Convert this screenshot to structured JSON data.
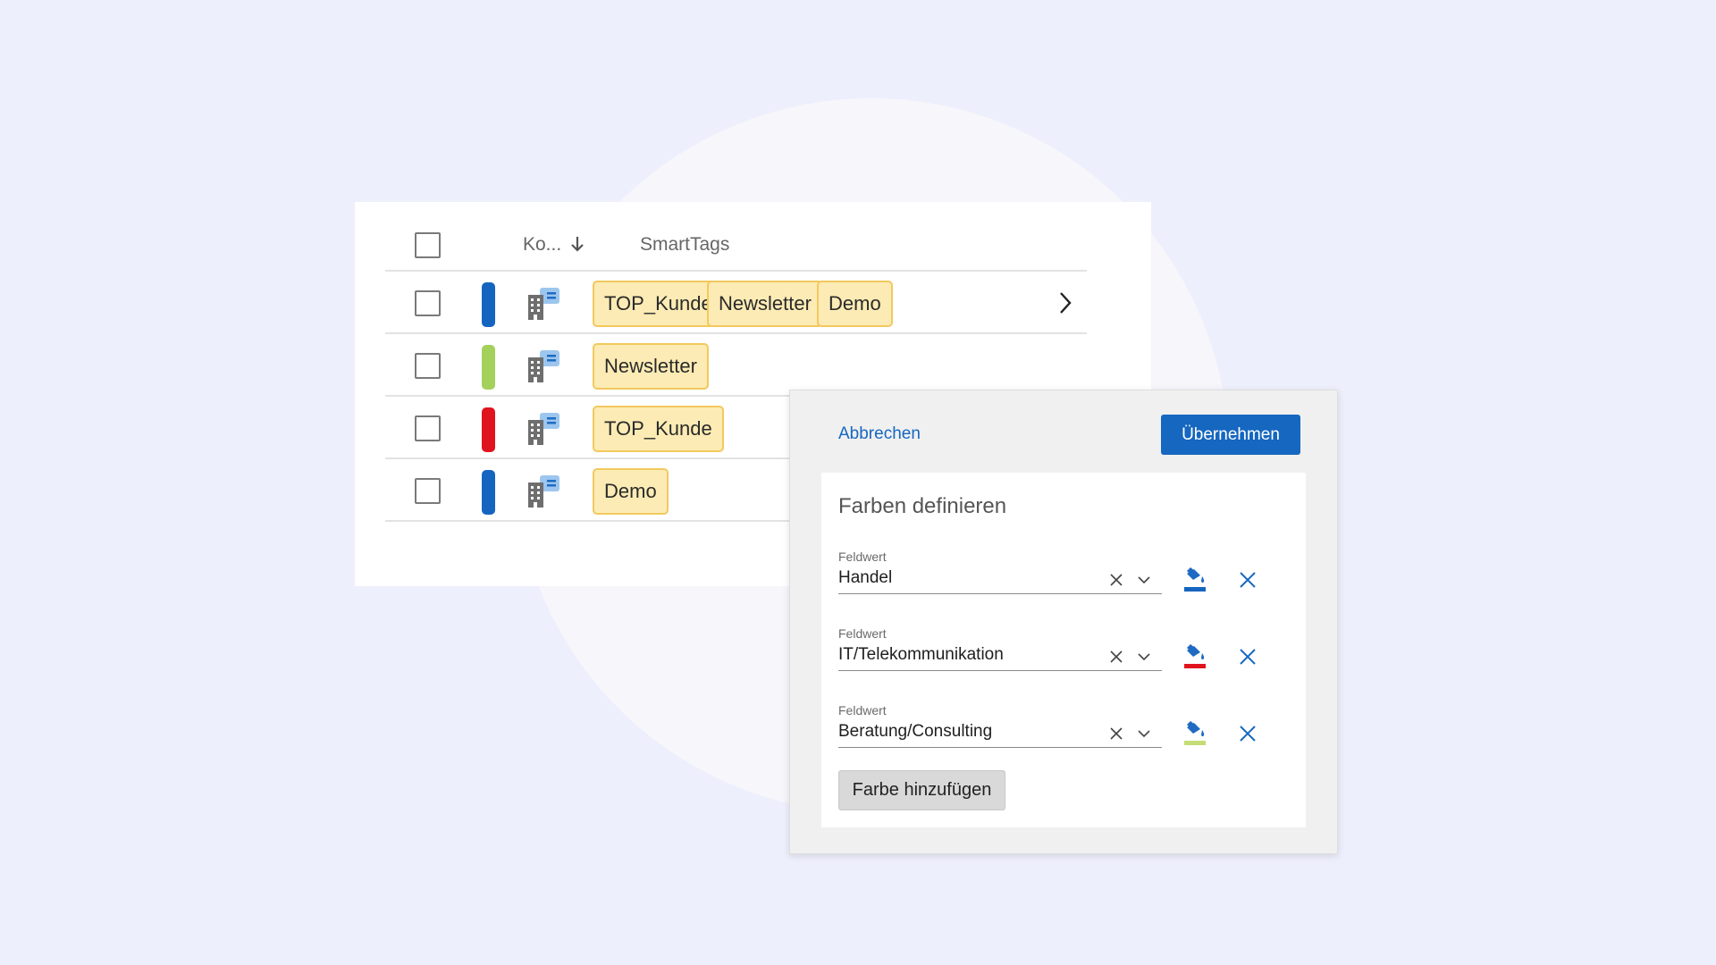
{
  "table": {
    "header": {
      "col_ko": "Ko...",
      "col_smarttags": "SmartTags"
    },
    "rows": [
      {
        "color": "#1565c0",
        "tags": [
          "TOP_Kunde",
          "Newsletter",
          "Demo"
        ]
      },
      {
        "color": "#a4d05c",
        "tags": [
          "Newsletter"
        ]
      },
      {
        "color": "#e0141e",
        "tags": [
          "TOP_Kunde"
        ]
      },
      {
        "color": "#1565c0",
        "tags": [
          "Demo"
        ]
      }
    ]
  },
  "dialog": {
    "cancel_label": "Abbrechen",
    "apply_label": "Übernehmen",
    "title": "Farben definieren",
    "fields": [
      {
        "label": "Feldwert",
        "value": "Handel",
        "color": "#1565c0"
      },
      {
        "label": "Feldwert",
        "value": "IT/Telekommunikation",
        "color": "#e0141e"
      },
      {
        "label": "Feldwert",
        "value": "Beratung/Consulting",
        "color": "#c5dd77"
      }
    ],
    "add_color_label": "Farbe hinzufügen"
  },
  "icons": {
    "company": "company-building-icon",
    "sort": "arrow-down-icon",
    "row_action": "chevron-right-icon",
    "clear": "close-icon",
    "dropdown": "chevron-down-icon",
    "fill": "paint-bucket-icon",
    "remove": "close-icon"
  },
  "colors": {
    "accent": "#1567c0",
    "tag_bg": "#fcebb4",
    "tag_border": "#f2c95e"
  }
}
